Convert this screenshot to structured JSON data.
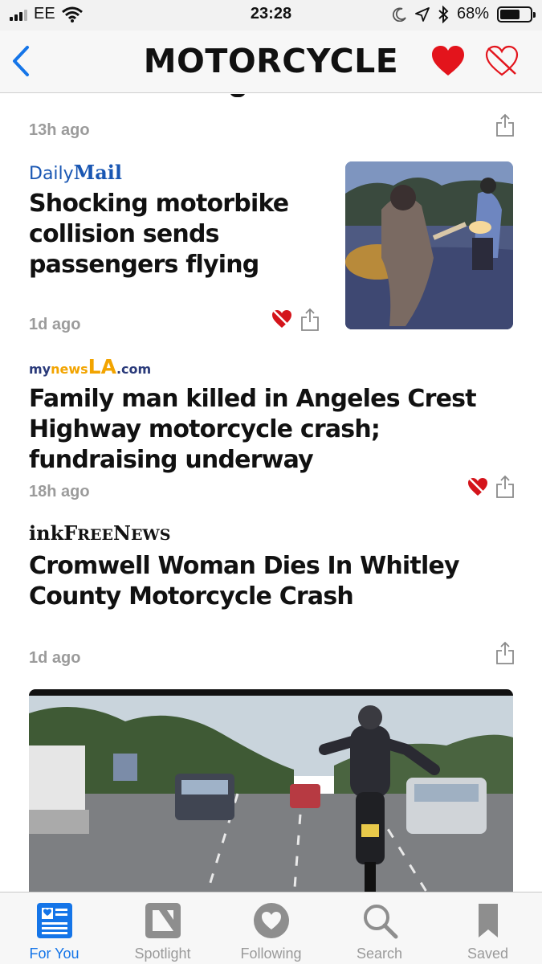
{
  "status_bar": {
    "carrier": "EE",
    "time": "23:28",
    "battery_percent": "68%",
    "battery_level": 0.68
  },
  "nav": {
    "title": "MOTORCYCLE",
    "back_icon": "chevron-left-icon",
    "favorite_icon": "heart-filled-icon",
    "unfavorite_icon": "heart-broken-icon"
  },
  "feed": {
    "top_item_time": "13h ago",
    "articles": [
      {
        "source": "Daily Mail",
        "source_parts": [
          "Daily",
          "Mail"
        ],
        "headline": "Shocking motorbike collision sends passengers flying",
        "time": "1d ago"
      },
      {
        "source": "mynewsLA.com",
        "source_parts": [
          "my",
          "news",
          "LA",
          ".com"
        ],
        "headline": "Family man killed in Angeles Crest Highway motorcycle crash; fundraising underway",
        "time": "18h ago"
      },
      {
        "source": "InkFreeNews",
        "source_parts": [
          "ink",
          "F",
          "REE",
          "N",
          "EWS"
        ],
        "headline": "Cromwell Woman Dies In Whitley County Motorcycle Crash",
        "time": "1d ago"
      }
    ]
  },
  "tabs": [
    {
      "label": "For You",
      "icon": "newspaper-icon",
      "active": true
    },
    {
      "label": "Spotlight",
      "icon": "spotlight-icon",
      "active": false
    },
    {
      "label": "Following",
      "icon": "heart-circle-icon",
      "active": false
    },
    {
      "label": "Search",
      "icon": "search-icon",
      "active": false
    },
    {
      "label": "Saved",
      "icon": "bookmark-icon",
      "active": false
    }
  ],
  "colors": {
    "accent": "#1575e8",
    "heart_red": "#e3141c",
    "inactive_gray": "#9a9a9a",
    "daily_mail_blue": "#1a57b3",
    "mynewsla_navy": "#2a3a7a",
    "mynewsla_orange": "#f2a400"
  }
}
